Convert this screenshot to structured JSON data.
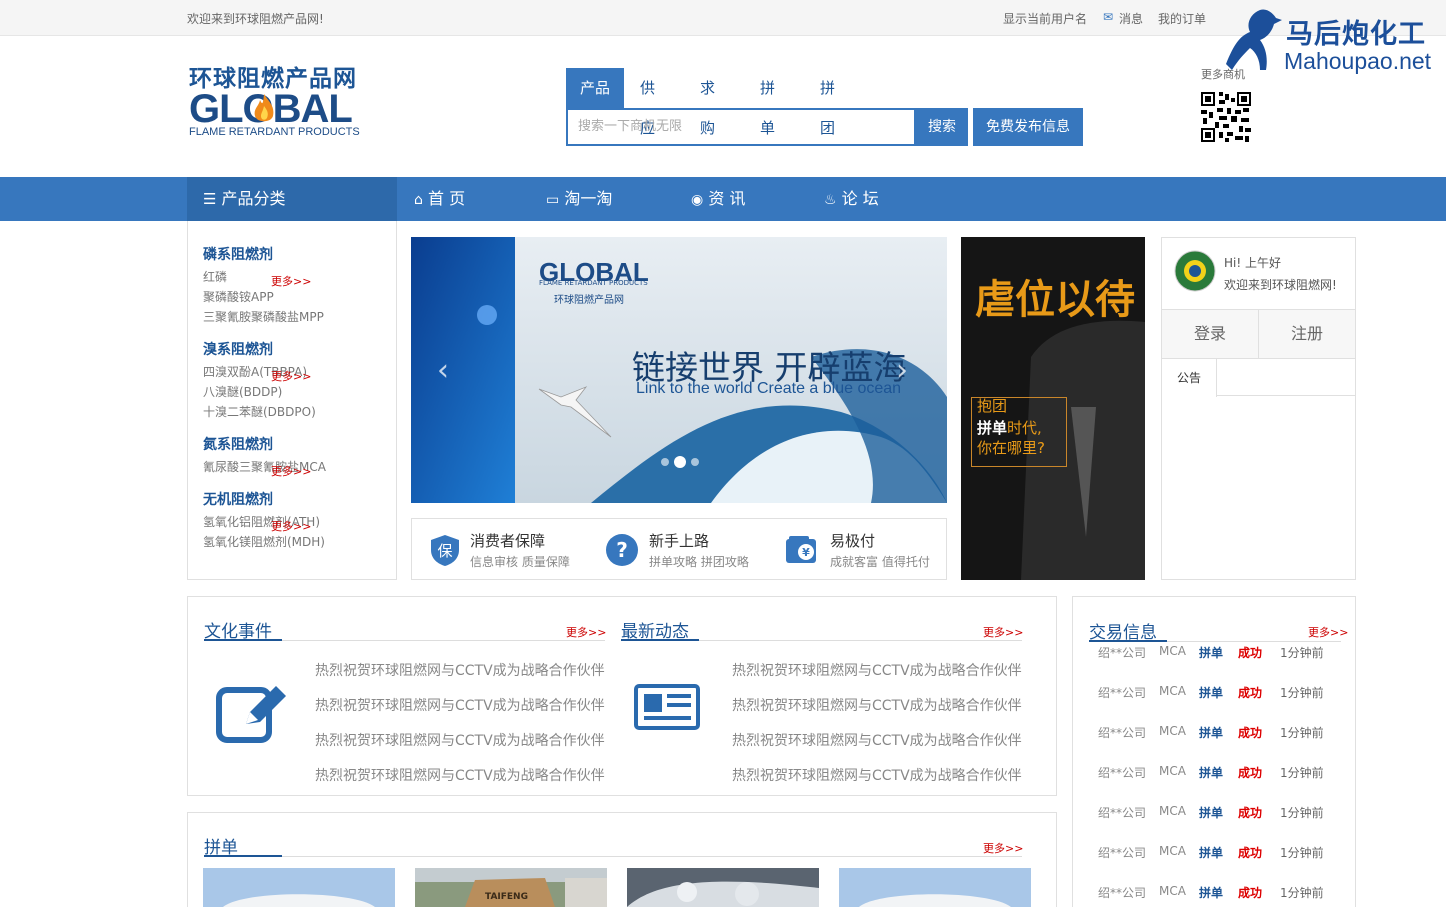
{
  "topbar": {
    "welcome": "欢迎来到环球阻燃产品网!",
    "username": "显示当前用户名",
    "messages": "消息",
    "orders": "我的订单"
  },
  "logo": {
    "cn": "环球阻燃产品网",
    "en": "GLOBAL",
    "sub": "FLAME RETARDANT PRODUCTS"
  },
  "watermark": {
    "cn": "马后炮化工",
    "en": "Mahoupao.net"
  },
  "search": {
    "tabs": [
      "产品",
      "供应",
      "求购",
      "拼单",
      "拼团"
    ],
    "placeholder": "搜索一下商机无限",
    "button": "搜索",
    "publish": "免费发布信息"
  },
  "qr": {
    "label": "更多商机"
  },
  "nav": {
    "category": "产品分类",
    "items": [
      {
        "label": "首 页",
        "icon": "home-icon"
      },
      {
        "label": "淘一淘",
        "icon": "card-icon"
      },
      {
        "label": "资 讯",
        "icon": "globe-icon"
      },
      {
        "label": "论 坛",
        "icon": "fire-icon"
      }
    ]
  },
  "categories": [
    {
      "title": "磷系阻燃剂",
      "items": [
        "红磷",
        "聚磷酸铵APP",
        "三聚氰胺聚磷酸盐MPP"
      ],
      "more": "更多>>"
    },
    {
      "title": "溴系阻燃剂",
      "items": [
        "四溴双酚A(TBBPA)",
        "八溴醚(BDDP)",
        "十溴二苯醚(DBDPO)"
      ],
      "more": "更多>>"
    },
    {
      "title": "氮系阻燃剂",
      "items": [
        "氰尿酸三聚氰胺盐MCA"
      ],
      "more": "更多>>"
    },
    {
      "title": "无机阻燃剂",
      "items": [
        "氢氧化铝阻燃剂(ATH)",
        "氢氧化镁阻燃剂(MDH)"
      ],
      "more": "更多>>"
    }
  ],
  "banner": {
    "brand": "GLOBAL",
    "brand_sub": "FLAME RETARDANT PRODUCTS",
    "brand_cn": "环球阻燃产品网",
    "headline": "链接世界 开辟蓝海",
    "subline": "Link to the world  Create a blue ocean"
  },
  "ad": {
    "title": "虐位以待",
    "line1": "抱团",
    "line2a": "拼单",
    "line2b": "时代,",
    "line3": "你在哪里?"
  },
  "guarantees": [
    {
      "title": "消费者保障",
      "sub": "信息审核  质量保障",
      "icon": "shield-icon"
    },
    {
      "title": "新手上路",
      "sub": "拼单攻略  拼团攻略",
      "icon": "question-icon"
    },
    {
      "title": "易极付",
      "sub": "成就客富  值得托付",
      "icon": "wallet-icon"
    }
  ],
  "user": {
    "greeting": "Hi! 上午好",
    "welcome": "欢迎来到环球阻燃网!",
    "login": "登录",
    "register": "注册",
    "notice_tab": "公告"
  },
  "culture": {
    "title": "文化事件",
    "more": "更多>>",
    "items": [
      "热烈祝贺环球阻燃网与CCTV成为战略合作伙伴",
      "热烈祝贺环球阻燃网与CCTV成为战略合作伙伴",
      "热烈祝贺环球阻燃网与CCTV成为战略合作伙伴",
      "热烈祝贺环球阻燃网与CCTV成为战略合作伙伴"
    ]
  },
  "latest": {
    "title": "最新动态",
    "more": "更多>>",
    "items": [
      "热烈祝贺环球阻燃网与CCTV成为战略合作伙伴",
      "热烈祝贺环球阻燃网与CCTV成为战略合作伙伴",
      "热烈祝贺环球阻燃网与CCTV成为战略合作伙伴",
      "热烈祝贺环球阻燃网与CCTV成为战略合作伙伴"
    ]
  },
  "trade": {
    "title": "交易信息",
    "more": "更多>>",
    "rows": [
      {
        "company": "绍**公司",
        "product": "MCA",
        "type": "拼单",
        "status": "成功",
        "time": "1分钟前"
      },
      {
        "company": "绍**公司",
        "product": "MCA",
        "type": "拼单",
        "status": "成功",
        "time": "1分钟前"
      },
      {
        "company": "绍**公司",
        "product": "MCA",
        "type": "拼单",
        "status": "成功",
        "time": "1分钟前"
      },
      {
        "company": "绍**公司",
        "product": "MCA",
        "type": "拼单",
        "status": "成功",
        "time": "1分钟前"
      },
      {
        "company": "绍**公司",
        "product": "MCA",
        "type": "拼单",
        "status": "成功",
        "time": "1分钟前"
      },
      {
        "company": "绍**公司",
        "product": "MCA",
        "type": "拼单",
        "status": "成功",
        "time": "1分钟前"
      },
      {
        "company": "绍**公司",
        "product": "MCA",
        "type": "拼单",
        "status": "成功",
        "time": "1分钟前"
      }
    ]
  },
  "group": {
    "title": "拼单",
    "more": "更多>>",
    "thumb_text": "TAIFENG"
  },
  "colors": {
    "primary": "#3777be",
    "dark": "#1d5595",
    "accent_red": "#cc0000"
  }
}
